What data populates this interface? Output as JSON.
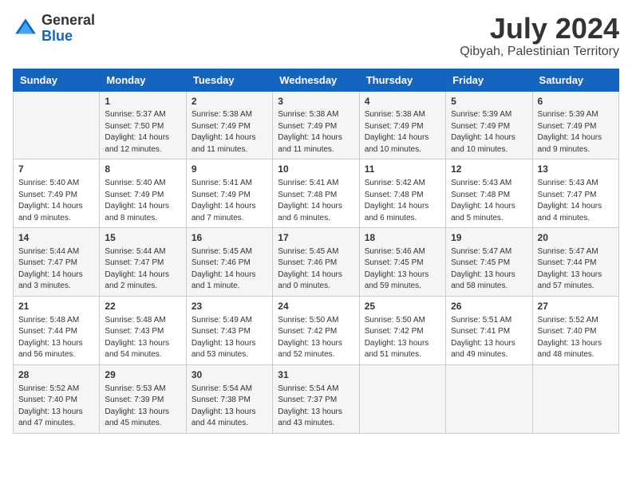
{
  "header": {
    "logo_general": "General",
    "logo_blue": "Blue",
    "month_year": "July 2024",
    "location": "Qibyah, Palestinian Territory"
  },
  "days_of_week": [
    "Sunday",
    "Monday",
    "Tuesday",
    "Wednesday",
    "Thursday",
    "Friday",
    "Saturday"
  ],
  "weeks": [
    [
      {
        "day": "",
        "info": ""
      },
      {
        "day": "1",
        "info": "Sunrise: 5:37 AM\nSunset: 7:50 PM\nDaylight: 14 hours\nand 12 minutes."
      },
      {
        "day": "2",
        "info": "Sunrise: 5:38 AM\nSunset: 7:49 PM\nDaylight: 14 hours\nand 11 minutes."
      },
      {
        "day": "3",
        "info": "Sunrise: 5:38 AM\nSunset: 7:49 PM\nDaylight: 14 hours\nand 11 minutes."
      },
      {
        "day": "4",
        "info": "Sunrise: 5:38 AM\nSunset: 7:49 PM\nDaylight: 14 hours\nand 10 minutes."
      },
      {
        "day": "5",
        "info": "Sunrise: 5:39 AM\nSunset: 7:49 PM\nDaylight: 14 hours\nand 10 minutes."
      },
      {
        "day": "6",
        "info": "Sunrise: 5:39 AM\nSunset: 7:49 PM\nDaylight: 14 hours\nand 9 minutes."
      }
    ],
    [
      {
        "day": "7",
        "info": "Sunrise: 5:40 AM\nSunset: 7:49 PM\nDaylight: 14 hours\nand 9 minutes."
      },
      {
        "day": "8",
        "info": "Sunrise: 5:40 AM\nSunset: 7:49 PM\nDaylight: 14 hours\nand 8 minutes."
      },
      {
        "day": "9",
        "info": "Sunrise: 5:41 AM\nSunset: 7:49 PM\nDaylight: 14 hours\nand 7 minutes."
      },
      {
        "day": "10",
        "info": "Sunrise: 5:41 AM\nSunset: 7:48 PM\nDaylight: 14 hours\nand 6 minutes."
      },
      {
        "day": "11",
        "info": "Sunrise: 5:42 AM\nSunset: 7:48 PM\nDaylight: 14 hours\nand 6 minutes."
      },
      {
        "day": "12",
        "info": "Sunrise: 5:43 AM\nSunset: 7:48 PM\nDaylight: 14 hours\nand 5 minutes."
      },
      {
        "day": "13",
        "info": "Sunrise: 5:43 AM\nSunset: 7:47 PM\nDaylight: 14 hours\nand 4 minutes."
      }
    ],
    [
      {
        "day": "14",
        "info": "Sunrise: 5:44 AM\nSunset: 7:47 PM\nDaylight: 14 hours\nand 3 minutes."
      },
      {
        "day": "15",
        "info": "Sunrise: 5:44 AM\nSunset: 7:47 PM\nDaylight: 14 hours\nand 2 minutes."
      },
      {
        "day": "16",
        "info": "Sunrise: 5:45 AM\nSunset: 7:46 PM\nDaylight: 14 hours\nand 1 minute."
      },
      {
        "day": "17",
        "info": "Sunrise: 5:45 AM\nSunset: 7:46 PM\nDaylight: 14 hours\nand 0 minutes."
      },
      {
        "day": "18",
        "info": "Sunrise: 5:46 AM\nSunset: 7:45 PM\nDaylight: 13 hours\nand 59 minutes."
      },
      {
        "day": "19",
        "info": "Sunrise: 5:47 AM\nSunset: 7:45 PM\nDaylight: 13 hours\nand 58 minutes."
      },
      {
        "day": "20",
        "info": "Sunrise: 5:47 AM\nSunset: 7:44 PM\nDaylight: 13 hours\nand 57 minutes."
      }
    ],
    [
      {
        "day": "21",
        "info": "Sunrise: 5:48 AM\nSunset: 7:44 PM\nDaylight: 13 hours\nand 56 minutes."
      },
      {
        "day": "22",
        "info": "Sunrise: 5:48 AM\nSunset: 7:43 PM\nDaylight: 13 hours\nand 54 minutes."
      },
      {
        "day": "23",
        "info": "Sunrise: 5:49 AM\nSunset: 7:43 PM\nDaylight: 13 hours\nand 53 minutes."
      },
      {
        "day": "24",
        "info": "Sunrise: 5:50 AM\nSunset: 7:42 PM\nDaylight: 13 hours\nand 52 minutes."
      },
      {
        "day": "25",
        "info": "Sunrise: 5:50 AM\nSunset: 7:42 PM\nDaylight: 13 hours\nand 51 minutes."
      },
      {
        "day": "26",
        "info": "Sunrise: 5:51 AM\nSunset: 7:41 PM\nDaylight: 13 hours\nand 49 minutes."
      },
      {
        "day": "27",
        "info": "Sunrise: 5:52 AM\nSunset: 7:40 PM\nDaylight: 13 hours\nand 48 minutes."
      }
    ],
    [
      {
        "day": "28",
        "info": "Sunrise: 5:52 AM\nSunset: 7:40 PM\nDaylight: 13 hours\nand 47 minutes."
      },
      {
        "day": "29",
        "info": "Sunrise: 5:53 AM\nSunset: 7:39 PM\nDaylight: 13 hours\nand 45 minutes."
      },
      {
        "day": "30",
        "info": "Sunrise: 5:54 AM\nSunset: 7:38 PM\nDaylight: 13 hours\nand 44 minutes."
      },
      {
        "day": "31",
        "info": "Sunrise: 5:54 AM\nSunset: 7:37 PM\nDaylight: 13 hours\nand 43 minutes."
      },
      {
        "day": "",
        "info": ""
      },
      {
        "day": "",
        "info": ""
      },
      {
        "day": "",
        "info": ""
      }
    ]
  ]
}
